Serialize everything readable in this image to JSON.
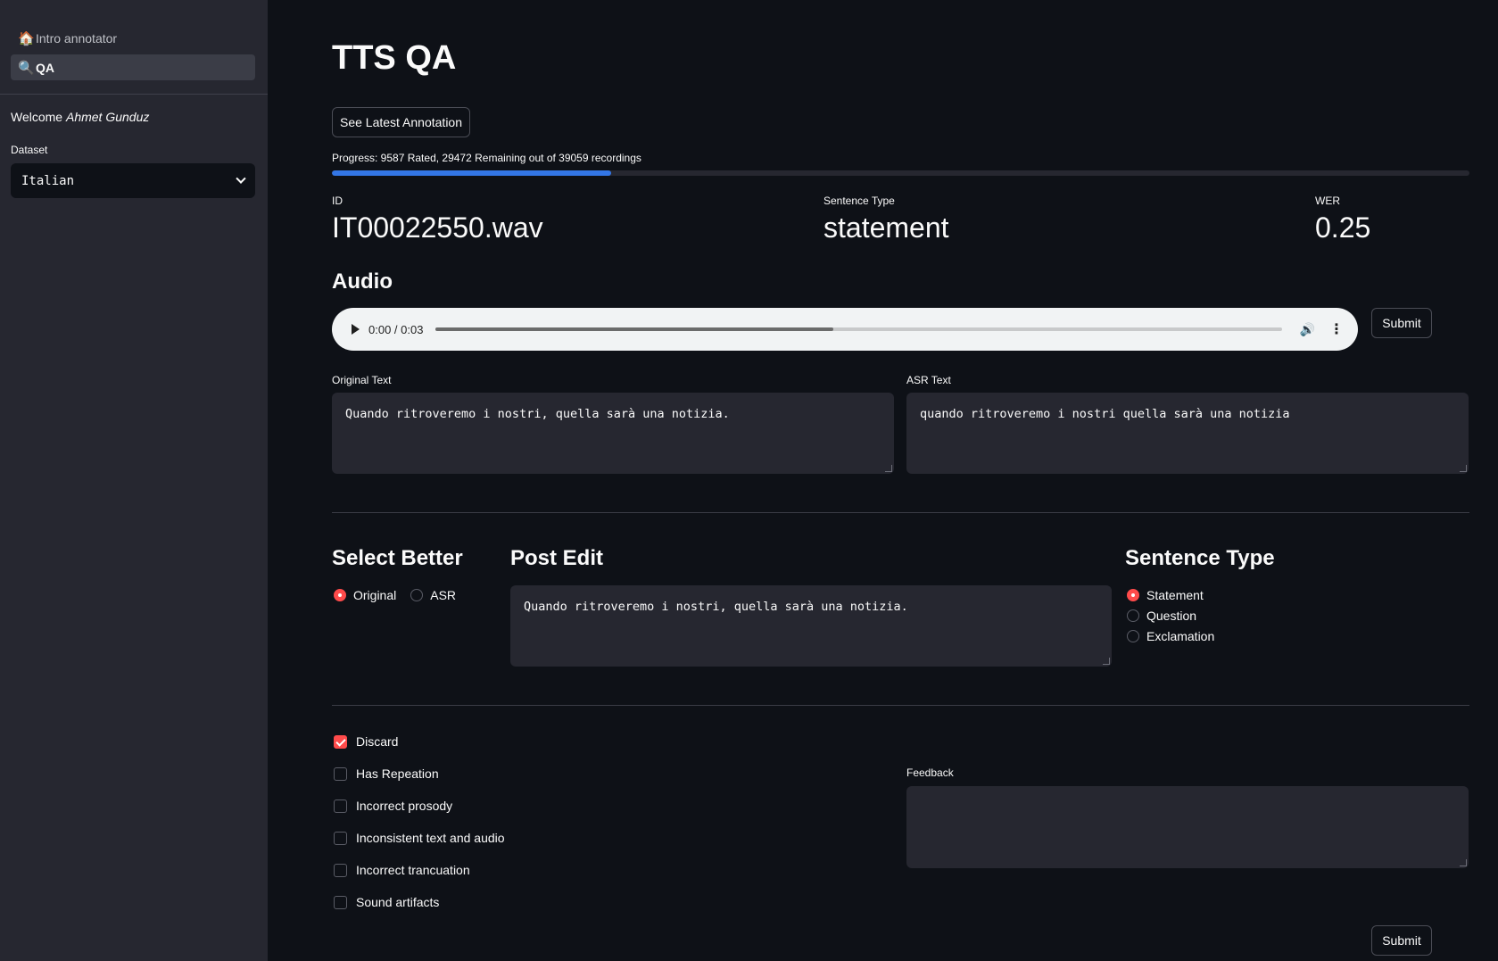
{
  "sidebar": {
    "nav": [
      {
        "icon": "house-icon",
        "glyph": "🏠",
        "label": "Intro annotator"
      },
      {
        "icon": "search-icon",
        "glyph": "🔍",
        "label": "QA"
      }
    ],
    "welcome_prefix": "Welcome ",
    "welcome_name": "Ahmet Gunduz",
    "dataset_label": "Dataset",
    "dataset_value": "Italian"
  },
  "main": {
    "title": "TTS QA",
    "latest_button": "See Latest Annotation",
    "progress_text": "Progress: 9587 Rated, 29472 Remaining out of 39059 recordings",
    "progress_fraction": 0.2455,
    "metrics": {
      "id_label": "ID",
      "id_value": "IT00022550.wav",
      "type_label": "Sentence Type",
      "type_value": "statement",
      "wer_label": "WER",
      "wer_value": "0.25"
    },
    "audio_heading": "Audio",
    "audio_time": "0:00 / 0:03",
    "audio_buffered_fraction": 0.47,
    "submit_label": "Submit",
    "original_text_label": "Original Text",
    "original_text": "Quando ritroveremo i nostri, quella sarà una notizia.",
    "asr_text_label": "ASR Text",
    "asr_text": "quando ritroveremo i nostri quella sarà una notizia",
    "select_better": {
      "heading": "Select Better",
      "options": [
        "Original",
        "ASR"
      ],
      "selected": "Original"
    },
    "post_edit": {
      "heading": "Post Edit",
      "text": "Quando ritroveremo i nostri, quella sarà una notizia."
    },
    "sentence_type": {
      "heading": "Sentence Type",
      "options": [
        "Statement",
        "Question",
        "Exclamation"
      ],
      "selected": "Statement"
    },
    "checks": [
      {
        "label": "Discard",
        "checked": true
      },
      {
        "label": "Has Repeation",
        "checked": false
      },
      {
        "label": "Incorrect prosody",
        "checked": false
      },
      {
        "label": "Inconsistent text and audio",
        "checked": false
      },
      {
        "label": "Incorrect trancuation",
        "checked": false
      },
      {
        "label": "Sound artifacts",
        "checked": false
      }
    ],
    "feedback_label": "Feedback",
    "feedback_value": "",
    "accent_color": "#ff4b4b",
    "progress_color": "#3376e6"
  }
}
